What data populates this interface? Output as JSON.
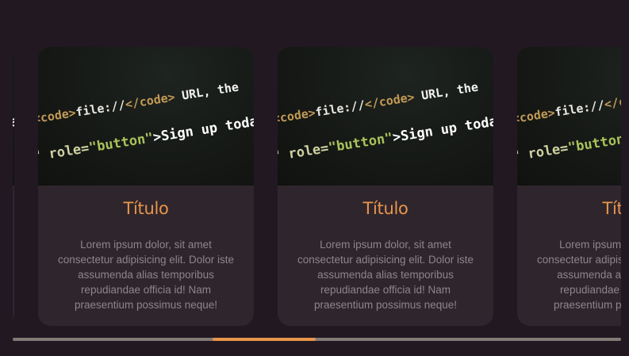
{
  "colors": {
    "background": "#221822",
    "card": "#2f262d",
    "accent": "#e8954a",
    "body_text": "#8e848c",
    "scrollbar_track": "#837a77"
  },
  "code_snippet": {
    "line1_prefix": "<code>",
    "line1_file": "file://",
    "line1_close": "</code>",
    "line1_rest": " URL, the",
    "line2_attr": "\" role=",
    "line2_value": "\"button\"",
    "line2_text": ">Sign up today"
  },
  "cards": [
    {
      "title": "Título",
      "text": "Lorem ipsum dolor, sit amet consectetur adipisicing elit. Dolor iste assumenda alias temporibus repudiandae officia id! Nam praesentium possimus neque!"
    },
    {
      "title": "Título",
      "text": "Lorem ipsum dolor, sit amet consectetur adipisicing elit. Dolor iste assumenda alias temporibus repudiandae officia id! Nam praesentium possimus neque!"
    },
    {
      "title": "Título",
      "text": "Lorem ipsum dolor, sit amet consectetur adipisicing elit. Dolor iste assumenda alias temporibus repudiandae officia id! Nam praesentium possimus neque!"
    },
    {
      "title": "Título",
      "text": "Lorem ipsum dolor, sit amet consectetur adipisicing elit. Dolor iste assumenda alias temporibus repudiandae officia id! Nam praesentium possimus neque!"
    }
  ],
  "scroll": {
    "thumb_start_fraction": 0.328,
    "thumb_length_fraction": 0.17
  }
}
